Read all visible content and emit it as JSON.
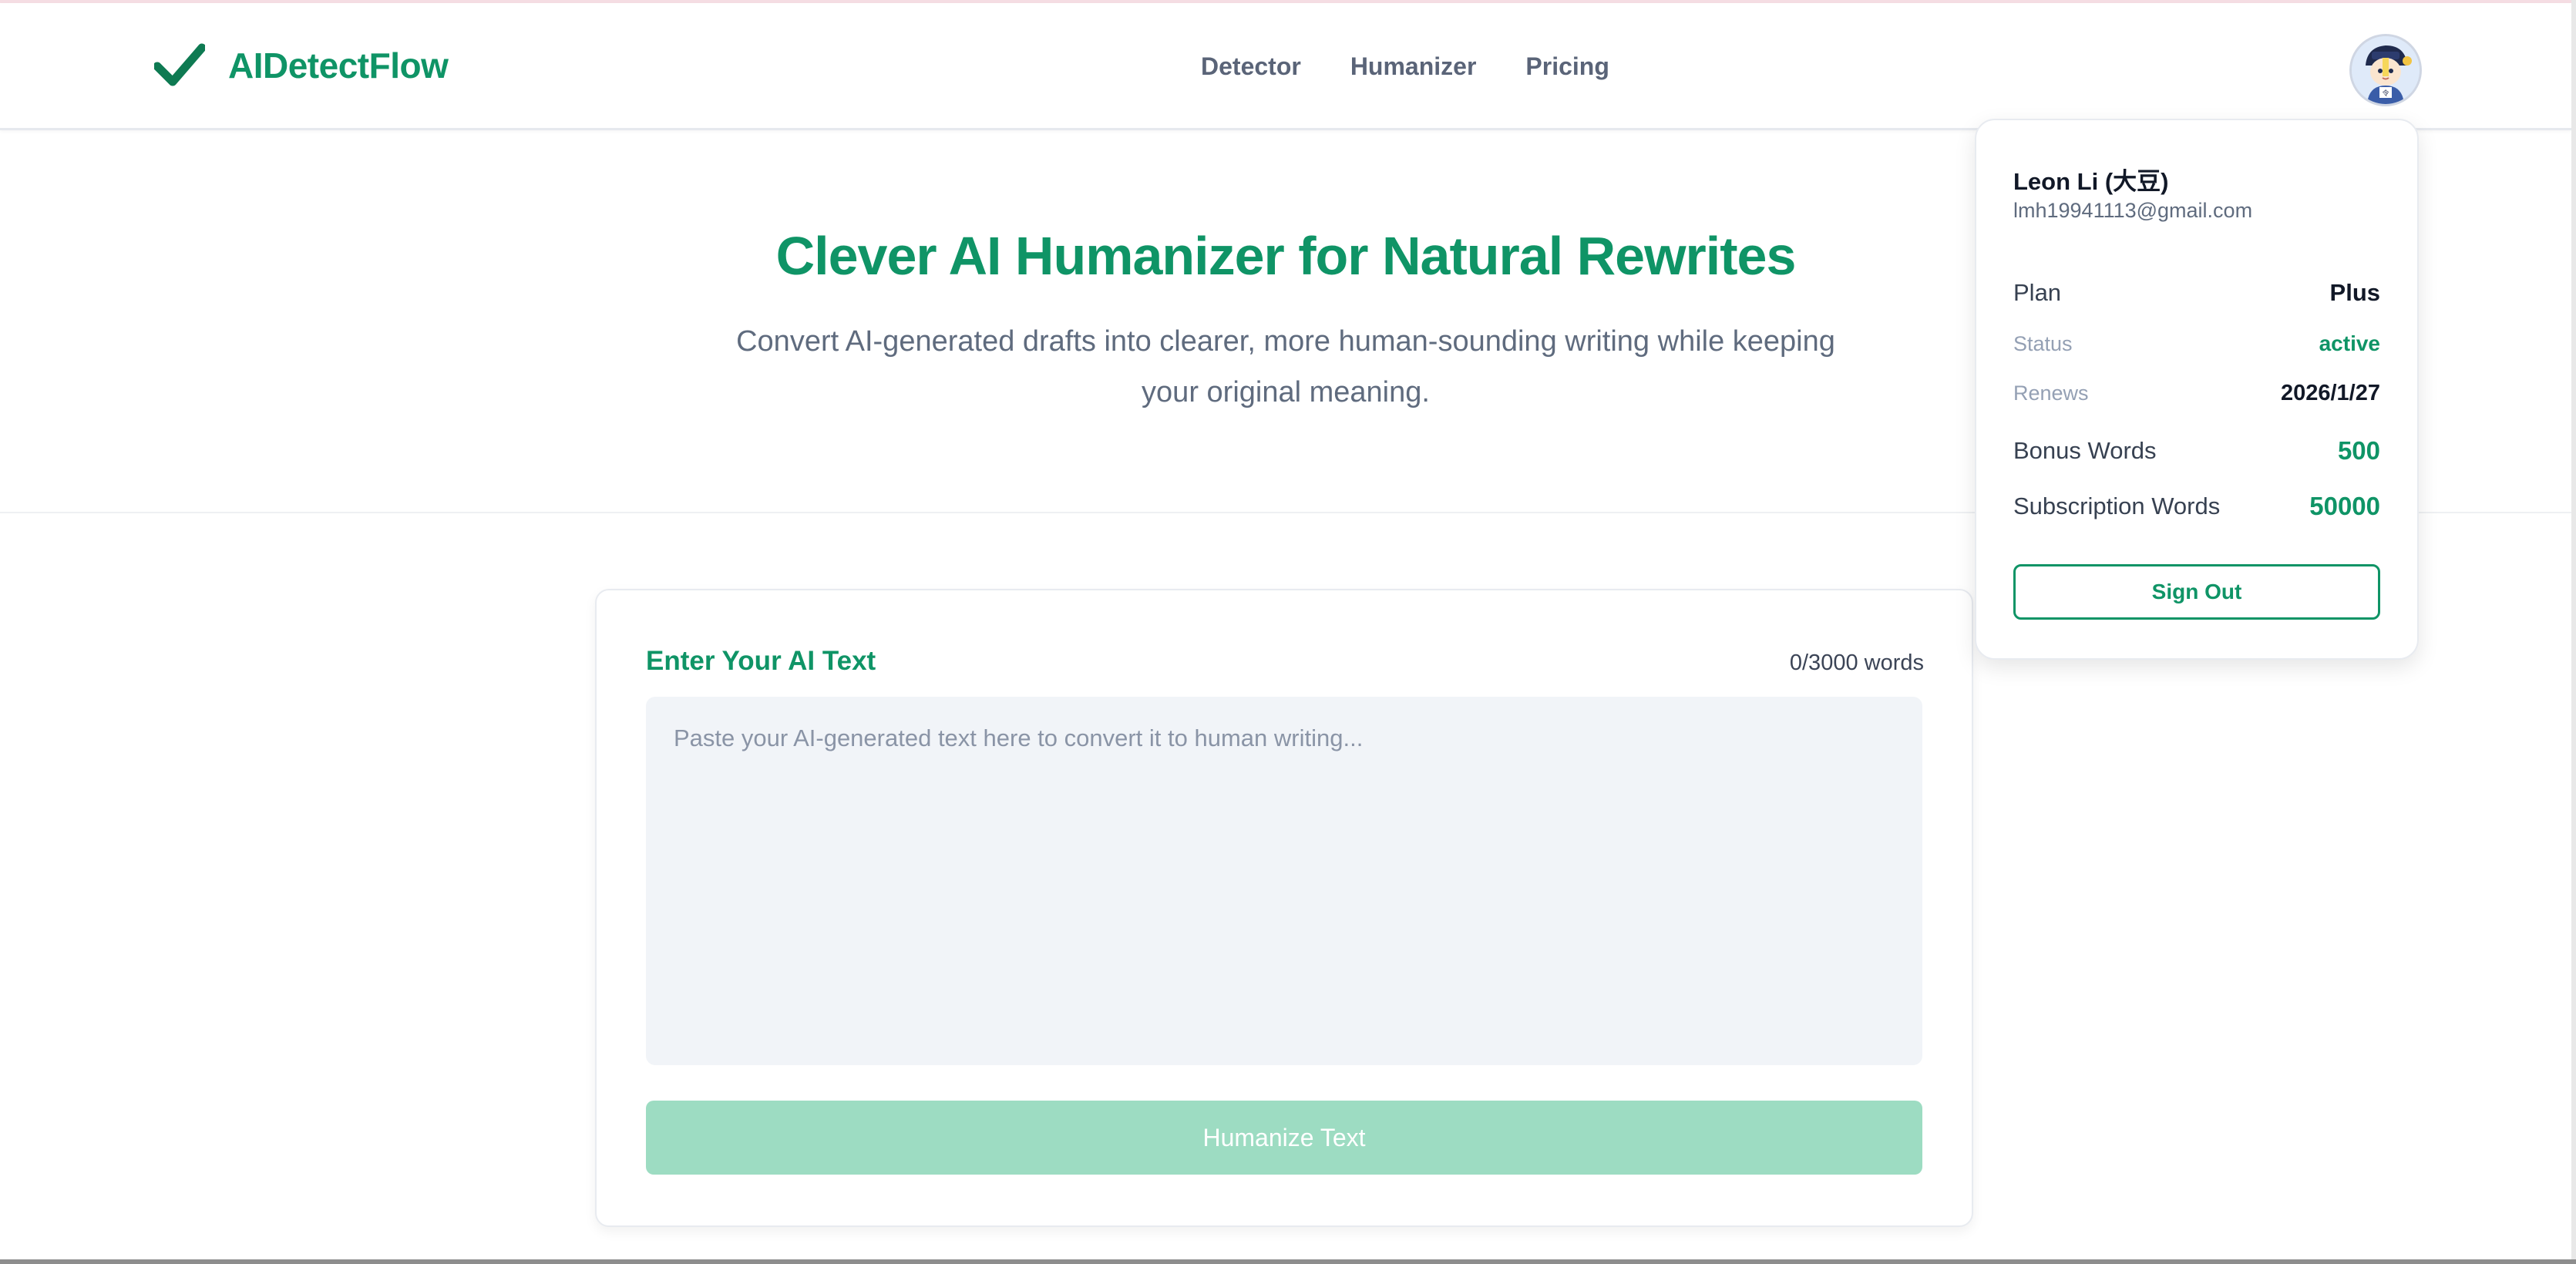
{
  "brand": {
    "name": "AIDetectFlow",
    "color": "#0f9466"
  },
  "nav": {
    "items": [
      {
        "label": "Detector"
      },
      {
        "label": "Humanizer"
      },
      {
        "label": "Pricing"
      }
    ]
  },
  "user_avatar": {
    "icon": "user-avatar-icon"
  },
  "hero": {
    "title": "Clever AI Humanizer for Natural Rewrites",
    "subtitle": "Convert AI-generated drafts into clearer, more human-sounding writing while keeping your original meaning."
  },
  "editor": {
    "title": "Enter Your AI Text",
    "word_count": "0/3000 words",
    "value": "",
    "placeholder": "Paste your AI-generated text here to convert it to human writing...",
    "submit_label": "Humanize Text",
    "submit_color": "#9ddcc2"
  },
  "account_menu": {
    "name": "Leon Li (大豆)",
    "email": "lmh19941113@gmail.com",
    "plan_label": "Plan",
    "plan_value": "Plus",
    "status_label": "Status",
    "status_value": "active",
    "renews_label": "Renews",
    "renews_value": "2026/1/27",
    "bonus_label": "Bonus Words",
    "bonus_value": "500",
    "subscription_label": "Subscription Words",
    "subscription_value": "50000",
    "sign_out_label": "Sign Out"
  }
}
